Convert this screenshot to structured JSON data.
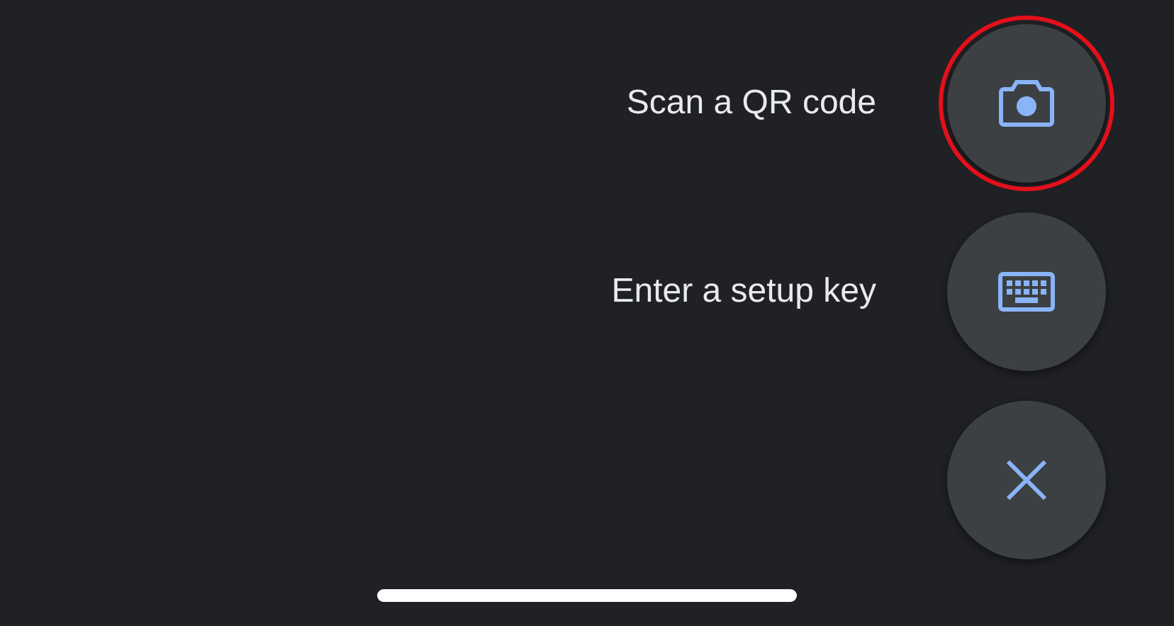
{
  "fab_menu": {
    "actions": [
      {
        "kind": "camera",
        "label": "Scan a QR code",
        "highlighted": true
      },
      {
        "kind": "keyboard",
        "label": "Enter a setup key",
        "highlighted": false
      },
      {
        "kind": "close",
        "highlighted": false
      }
    ]
  },
  "home_indicator": {
    "visible": true
  }
}
